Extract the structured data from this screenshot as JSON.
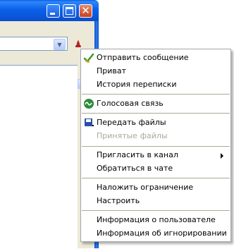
{
  "window": {
    "title_buttons": [
      "minimize",
      "maximize",
      "close"
    ],
    "close_glyph": "✕"
  },
  "toolbar": {
    "combo_arrow": "▼",
    "user_icon": "user-icon"
  },
  "context_menu": {
    "items": [
      {
        "label": "Отправить сообщение",
        "icon": "send-message-icon",
        "enabled": true
      },
      {
        "label": "Приват",
        "enabled": true
      },
      {
        "label": "История переписки",
        "enabled": true
      },
      {
        "label": "Голосовая связь",
        "icon": "voice-call-icon",
        "enabled": true
      },
      {
        "label": "Передать файлы",
        "icon": "send-files-icon",
        "enabled": true
      },
      {
        "label": "Принятые файлы",
        "enabled": false
      },
      {
        "label": "Пригласить в канал",
        "enabled": true,
        "submenu": true
      },
      {
        "label": "Обратиться в чате",
        "enabled": true
      },
      {
        "label": "Наложить ограничение",
        "enabled": true
      },
      {
        "label": "Настроить",
        "enabled": true
      },
      {
        "label": "Информация о пользователе",
        "enabled": true
      },
      {
        "label": "Информация об игнорировании",
        "enabled": true
      }
    ]
  },
  "colors": {
    "titlebar": "#0a5fe6",
    "close_button": "#c8401f",
    "window_face": "#ece9d8",
    "menu_bg": "#ffffff",
    "separator": "#aca899",
    "disabled_text": "#aca899"
  }
}
